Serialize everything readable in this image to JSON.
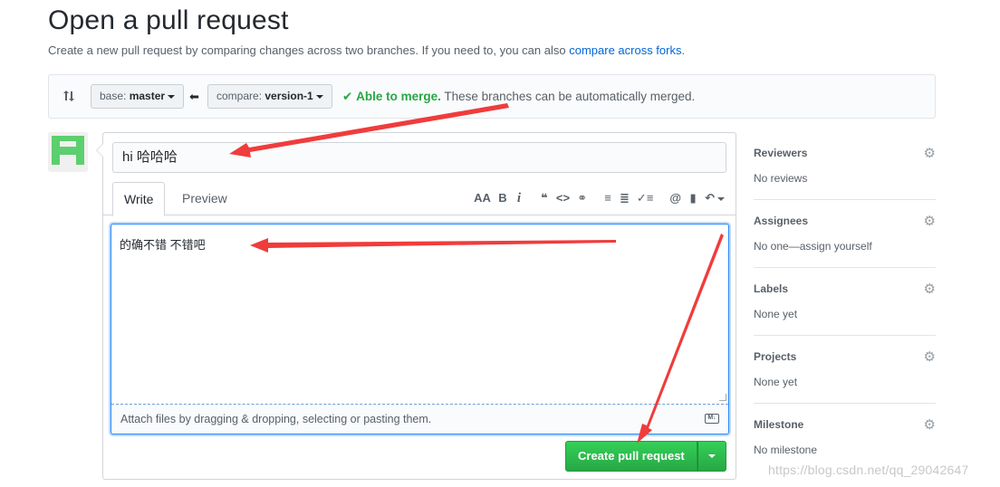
{
  "page": {
    "title": "Open a pull request",
    "subtitle": "Create a new pull request by comparing changes across two branches. If you need to, you can also ",
    "subtitle_link": "compare across forks",
    "subtitle_end": "."
  },
  "range": {
    "base_prefix": "base: ",
    "base_branch": "master",
    "compare_prefix": "compare: ",
    "compare_branch": "version-1",
    "merge_ok": "Able to merge.",
    "merge_msg": " These branches can be automatically merged.",
    "merge_color": "#28a745"
  },
  "form": {
    "title_value": "hi 哈哈哈",
    "tabs": {
      "write": "Write",
      "preview": "Preview"
    },
    "toolbar": [
      "header-icon",
      "bold-icon",
      "italic-icon",
      "quote-icon",
      "code-icon",
      "link-icon",
      "bullet-list-icon",
      "numbered-list-icon",
      "task-list-icon",
      "mention-icon",
      "bookmark-icon",
      "reply-icon"
    ],
    "body_text": "的确不错  不错吧",
    "attach_hint": "Attach files by dragging & dropping, selecting or pasting them.",
    "submit_label": "Create pull request",
    "submit_color": "#28a745"
  },
  "sidebar": [
    {
      "heading": "Reviewers",
      "value": "No reviews"
    },
    {
      "heading": "Assignees",
      "value": "No one—assign yourself"
    },
    {
      "heading": "Labels",
      "value": "None yet"
    },
    {
      "heading": "Projects",
      "value": "None yet"
    },
    {
      "heading": "Milestone",
      "value": "No milestone"
    }
  ],
  "watermark": "https://blog.csdn.net/qq_29042647",
  "annotation_color": "#f03c3c"
}
